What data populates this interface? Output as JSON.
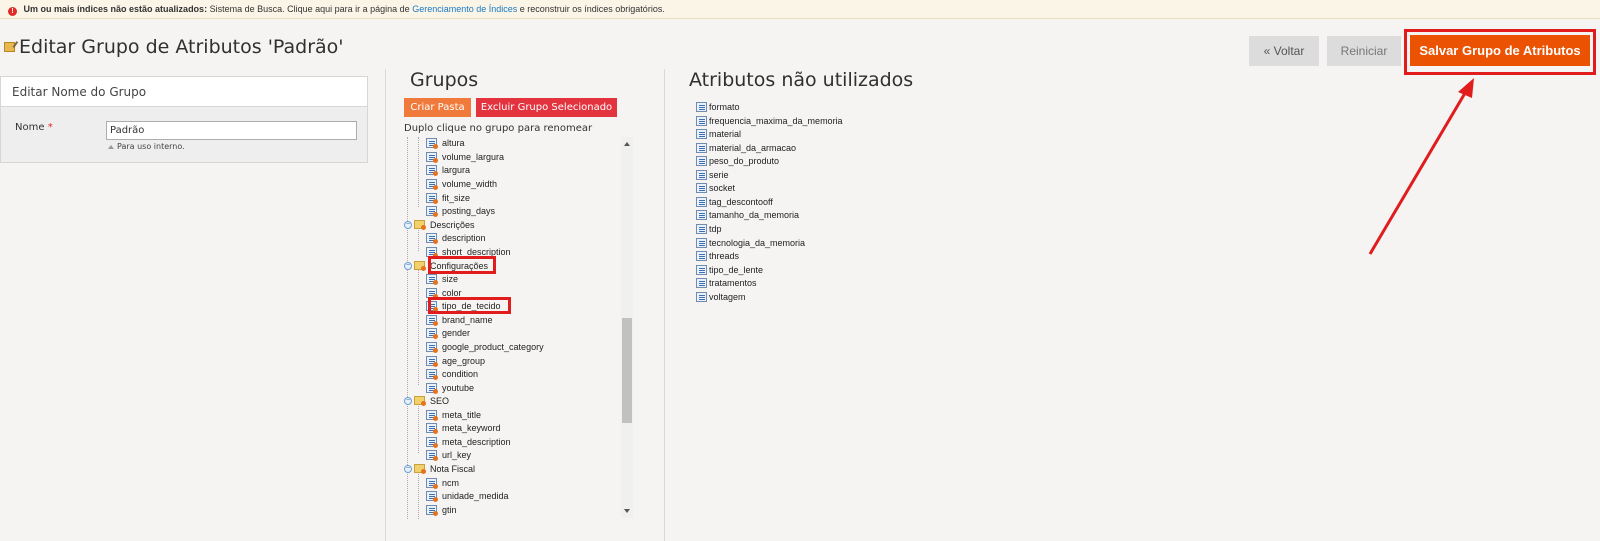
{
  "notice": {
    "icon": "error-icon",
    "text_before": "Um ou mais índices não estão atualizados:",
    "text_mid": " Sistema de Busca. Clique aqui para ir a página de ",
    "link": "Gerenciamento de Índices",
    "text_after": " e reconstruir os índices obrigatórios."
  },
  "page": {
    "title": "Editar Grupo de Atributos 'Padrão'"
  },
  "actions": {
    "back_label": "« Voltar",
    "reset_label": "Reiniciar",
    "save_label": "Salvar Grupo de Atributos",
    "save_color": "#eb5202"
  },
  "edit_name": {
    "heading": "Editar Nome do Grupo",
    "field_label": "Nome",
    "required_mark": "*",
    "value": "Padrão",
    "note": "Para uso interno."
  },
  "groups": {
    "title": "Grupos",
    "create_folder_label": "Criar Pasta",
    "delete_group_label": "Excluir Grupo Selecionado",
    "hint": "Duplo clique no grupo para renomear",
    "tree": [
      {
        "type": "attr",
        "label": "altura"
      },
      {
        "type": "attr",
        "label": "volume_largura"
      },
      {
        "type": "attr",
        "label": "largura"
      },
      {
        "type": "attr",
        "label": "volume_width"
      },
      {
        "type": "attr",
        "label": "fit_size"
      },
      {
        "type": "attr",
        "label": "posting_days"
      },
      {
        "type": "folder",
        "label": "Descrições"
      },
      {
        "type": "attr",
        "label": "description"
      },
      {
        "type": "attr",
        "label": "short_description"
      },
      {
        "type": "folder",
        "label": "Configurações"
      },
      {
        "type": "attr",
        "label": "size"
      },
      {
        "type": "attr",
        "label": "color"
      },
      {
        "type": "attr",
        "label": "tipo_de_tecido"
      },
      {
        "type": "attr",
        "label": "brand_name"
      },
      {
        "type": "attr",
        "label": "gender"
      },
      {
        "type": "attr",
        "label": "google_product_category"
      },
      {
        "type": "attr",
        "label": "age_group"
      },
      {
        "type": "attr",
        "label": "condition"
      },
      {
        "type": "attr",
        "label": "youtube"
      },
      {
        "type": "folder",
        "label": "SEO"
      },
      {
        "type": "attr",
        "label": "meta_title"
      },
      {
        "type": "attr",
        "label": "meta_keyword"
      },
      {
        "type": "attr",
        "label": "meta_description"
      },
      {
        "type": "attr",
        "label": "url_key"
      },
      {
        "type": "folder",
        "label": "Nota Fiscal"
      },
      {
        "type": "attr",
        "label": "ncm"
      },
      {
        "type": "attr",
        "label": "unidade_medida"
      },
      {
        "type": "attr",
        "label": "gtin"
      }
    ]
  },
  "unused": {
    "title": "Atributos não utilizados",
    "items": [
      "formato",
      "frequencia_maxima_da_memoria",
      "material",
      "material_da_armacao",
      "peso_do_produto",
      "serie",
      "socket",
      "tag_descontooff",
      "tamanho_da_memoria",
      "tdp",
      "tecnologia_da_memoria",
      "threads",
      "tipo_de_lente",
      "tratamentos",
      "voltagem"
    ]
  },
  "annotation": {
    "color": "#e01c1c"
  }
}
